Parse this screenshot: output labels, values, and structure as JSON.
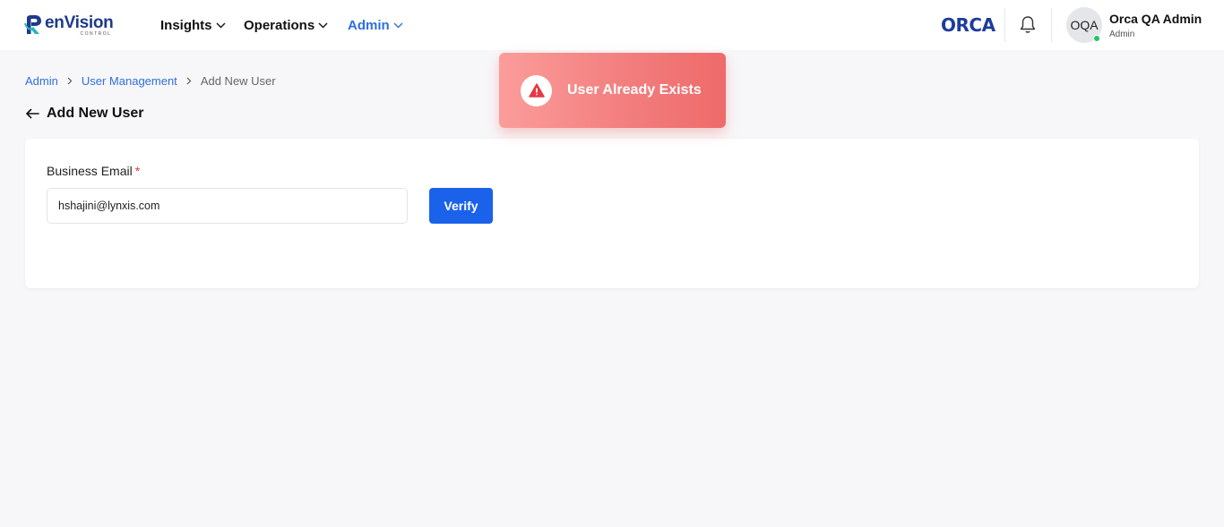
{
  "header": {
    "logo_text": "enVision",
    "logo_subtext": "CONTROL",
    "nav": [
      {
        "label": "Insights",
        "active": false
      },
      {
        "label": "Operations",
        "active": false
      },
      {
        "label": "Admin",
        "active": true
      }
    ],
    "partner_logo_text": "ORCA",
    "user": {
      "initials": "OQA",
      "name": "Orca QA Admin",
      "role": "Admin",
      "online": true
    }
  },
  "breadcrumb": {
    "items": [
      "Admin",
      "User Management"
    ],
    "current": "Add New User"
  },
  "page": {
    "title": "Add New User"
  },
  "form": {
    "email_label": "Business Email",
    "required_marker": "*",
    "email_value": "hshajini@lynxis.com",
    "verify_label": "Verify"
  },
  "toast": {
    "message": "User Already Exists",
    "type": "error",
    "icon": "warning-triangle-icon"
  },
  "colors": {
    "accent": "#1a62ea",
    "active_nav": "#2f6fde",
    "error": "#ef6a6a",
    "online": "#22c55e"
  }
}
